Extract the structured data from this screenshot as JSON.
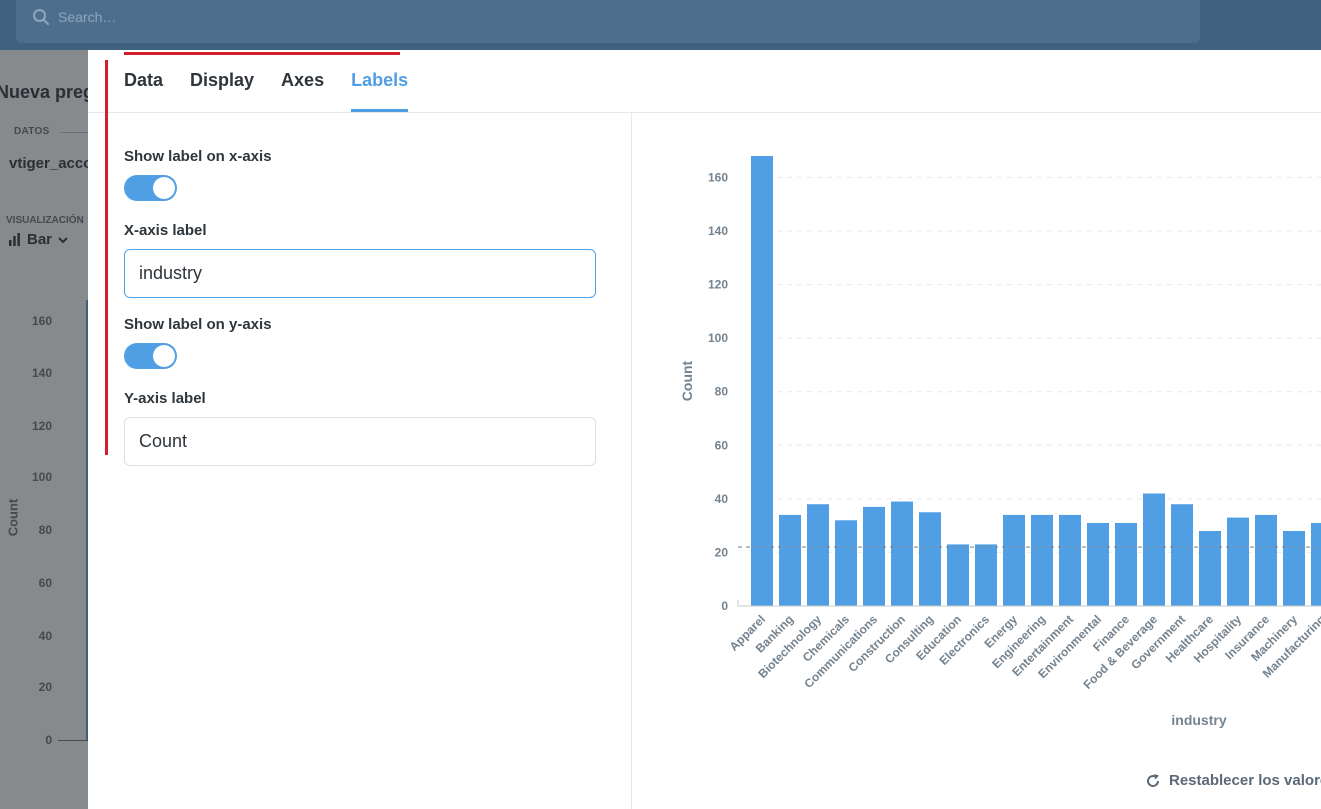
{
  "topnav": {
    "search_placeholder": "Search…"
  },
  "background": {
    "title": "Nueva pregunta",
    "datos_label": "DATOS",
    "table_name": "vtiger_account",
    "visualization_label": "VISUALIZACIÓN",
    "visualization_value": "Bar",
    "ylabel": "Count",
    "yticks": [
      "160",
      "140",
      "120",
      "100",
      "80",
      "60",
      "40",
      "20",
      "0"
    ]
  },
  "tabs": [
    {
      "label": "Data"
    },
    {
      "label": "Display"
    },
    {
      "label": "Axes"
    },
    {
      "label": "Labels",
      "active": true
    }
  ],
  "labels_form": {
    "show_x_label": "Show label on x-axis",
    "show_x_value": true,
    "x_axis_label": "X-axis label",
    "x_axis_value": "industry",
    "show_y_label": "Show label on y-axis",
    "show_y_value": true,
    "y_axis_label": "Y-axis label",
    "y_axis_value": "Count"
  },
  "chart_data": {
    "type": "bar",
    "xlabel": "industry",
    "ylabel": "Count",
    "ylim": [
      0,
      168
    ],
    "yticks": [
      0,
      20,
      40,
      60,
      80,
      100,
      120,
      140,
      160
    ],
    "reference_line": 22,
    "grid": true,
    "color": "#509ee3",
    "categories": [
      "Apparel",
      "Banking",
      "Biotechnology",
      "Chemicals",
      "Communications",
      "Construction",
      "Consulting",
      "Education",
      "Electronics",
      "Energy",
      "Engineering",
      "Entertainment",
      "Environmental",
      "Finance",
      "Food & Beverage",
      "Government",
      "Healthcare",
      "Hospitality",
      "Insurance",
      "Machinery",
      "Manufacturing"
    ],
    "values": [
      168,
      34,
      38,
      32,
      37,
      39,
      35,
      23,
      23,
      34,
      34,
      34,
      31,
      31,
      42,
      38,
      28,
      33,
      34,
      28,
      31
    ]
  },
  "reset_label": "Restablecer los valores",
  "colors": {
    "accent": "#509ee3",
    "highlight": "#d21f2b",
    "nav": "#3f617f"
  }
}
